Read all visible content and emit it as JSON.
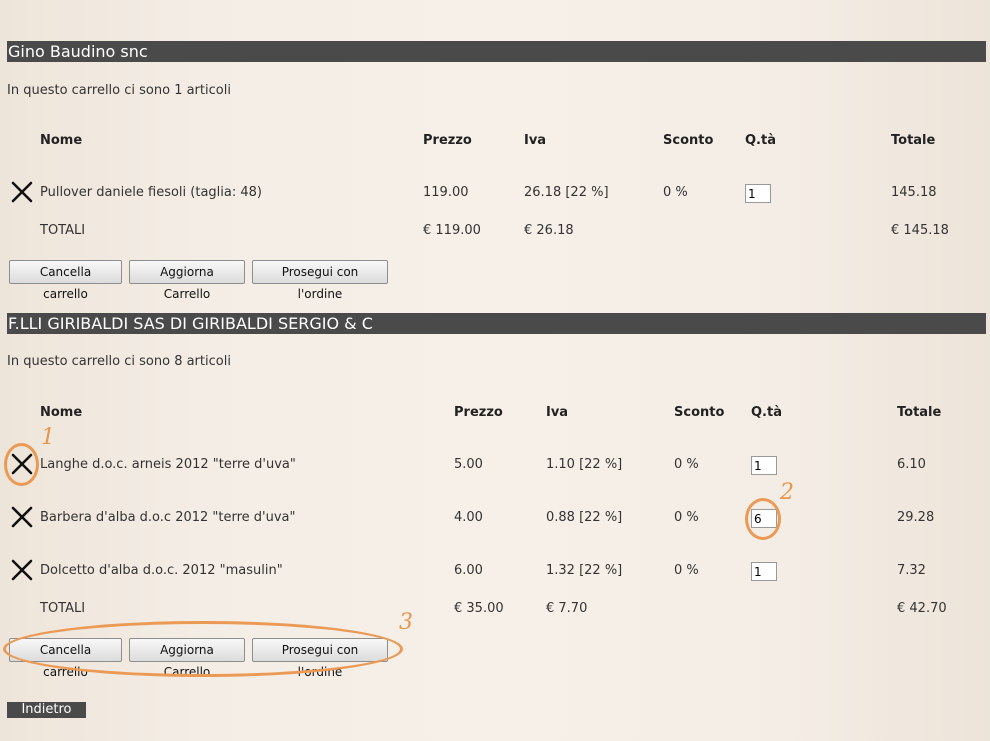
{
  "columns": {
    "name": "Nome",
    "price": "Prezzo",
    "vat": "Iva",
    "discount": "Sconto",
    "qty": "Q.tà",
    "total": "Totale"
  },
  "buttons": {
    "clear": "Cancella carrello",
    "update": "Aggiorna Carrello",
    "proceed": "Prosegui con l'ordine"
  },
  "back_label": "Indietro",
  "remove_icon": "x-icon",
  "accent_color": "#eb9a55",
  "carts": [
    {
      "shop": "Gino Baudino snc",
      "count_text": "In questo carrello ci sono 1 articoli",
      "items": [
        {
          "name": "Pullover daniele fiesoli (taglia: 48)",
          "price": "119.00",
          "vat": "26.18 [22 %]",
          "discount": "0 %",
          "qty": "1",
          "total": "145.18"
        }
      ],
      "totals": {
        "label": "TOTALI",
        "price": "€ 119.00",
        "vat": "€ 26.18",
        "total": "€ 145.18"
      }
    },
    {
      "shop": "F.LLI GIRIBALDI SAS DI GIRIBALDI SERGIO & C",
      "count_text": "In questo carrello ci sono 8 articoli",
      "items": [
        {
          "name": "Langhe d.o.c. arneis 2012 \"terre d'uva\"",
          "price": "5.00",
          "vat": "1.10 [22 %]",
          "discount": "0 %",
          "qty": "1",
          "total": "6.10"
        },
        {
          "name": "Barbera d'alba d.o.c 2012 \"terre d'uva\"",
          "price": "4.00",
          "vat": "0.88 [22 %]",
          "discount": "0 %",
          "qty": "6",
          "total": "29.28"
        },
        {
          "name": "Dolcetto d'alba d.o.c. 2012 \"masulin\"",
          "price": "6.00",
          "vat": "1.32 [22 %]",
          "discount": "0 %",
          "qty": "1",
          "total": "7.32"
        }
      ],
      "totals": {
        "label": "TOTALI",
        "price": "€ 35.00",
        "vat": "€ 7.70",
        "total": "€ 42.70"
      }
    }
  ],
  "annotations": [
    "1",
    "2",
    "3"
  ]
}
